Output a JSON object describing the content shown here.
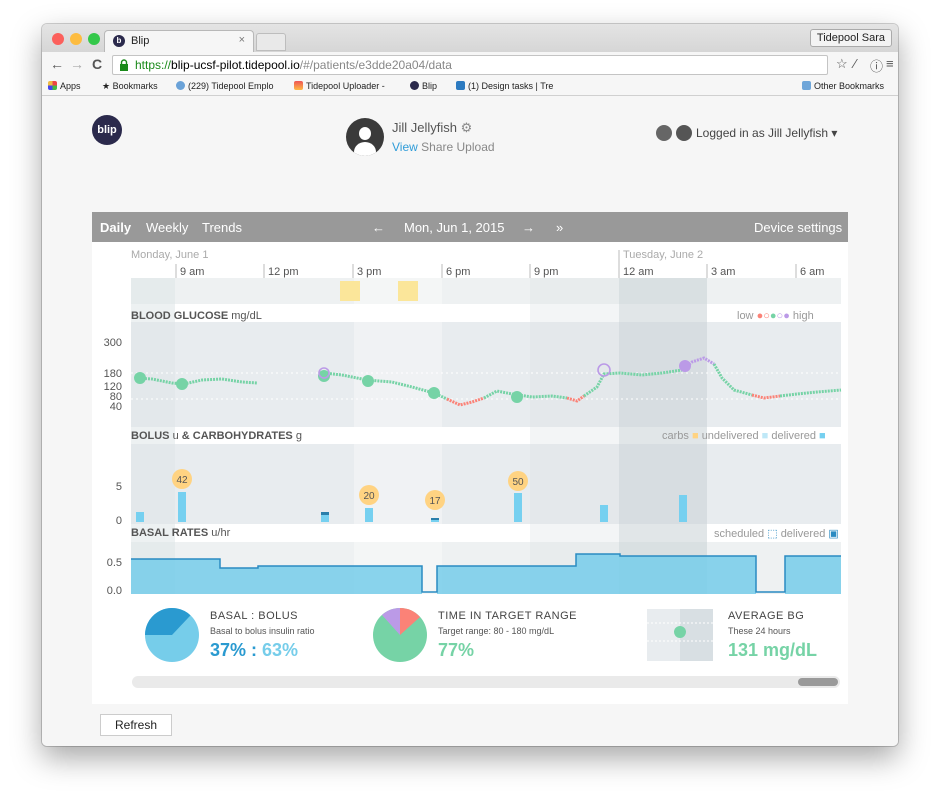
{
  "browser": {
    "tab_title": "Blip",
    "tab_close": "×",
    "profile_name": "Tidepool Sara",
    "url_scheme": "https://",
    "url_host": "blip-ucsf-pilot.tidepool.io",
    "url_path": "/#/patients/e3dde20a04/data",
    "bookmarks": [
      "Apps",
      "Bookmarks",
      "(229) Tidepool Emplo",
      "Tidepool Uploader -",
      "Blip",
      "(1) Design tasks | Tre"
    ],
    "other_bookmarks": "Other Bookmarks"
  },
  "header": {
    "logo_text": "blip",
    "patient_name": "Jill Jellyfish",
    "links": [
      "View",
      "Share",
      "Upload"
    ],
    "logged_in": "Logged in as Jill Jellyfish"
  },
  "nav": {
    "daily": "Daily",
    "weekly": "Weekly",
    "trends": "Trends",
    "prev": "←",
    "date": "Mon, Jun 1, 2015",
    "next": "→",
    "most_recent": "»",
    "device_settings": "Device settings"
  },
  "timeline": {
    "day1": "Monday, June 1",
    "day2": "Tuesday, June 2",
    "ticks": [
      "9 am",
      "12 pm",
      "3 pm",
      "6 pm",
      "9 pm",
      "12 am",
      "3 am",
      "6 am"
    ]
  },
  "blood_glucose": {
    "title": "BLOOD GLUCOSE",
    "unit": "mg/dL",
    "legend_low": "low",
    "legend_high": "high",
    "y_ticks": [
      "300",
      "180",
      "120",
      "80",
      "40"
    ],
    "colors": {
      "low": "#fb8277",
      "target": "#76d3a6",
      "high": "#bb9ae7"
    }
  },
  "bolus": {
    "title": "BOLUS",
    "unit_u": "u",
    "and_carbs": "& CARBOHYDRATES",
    "unit_g": "g",
    "legend_carbs": "carbs",
    "legend_undelivered": "undelivered",
    "legend_delivered": "delivered",
    "y_ticks": [
      "5",
      "0"
    ],
    "carbs": [
      "42",
      "20",
      "17",
      "50"
    ]
  },
  "basal": {
    "title": "BASAL RATES",
    "unit": "u/hr",
    "legend_scheduled": "scheduled",
    "legend_delivered": "delivered",
    "y_ticks": [
      "0.5",
      "0.0"
    ]
  },
  "stats": {
    "basal_bolus": {
      "title": "BASAL : BOLUS",
      "sub": "Basal to bolus insulin ratio",
      "basal_pct": "37%",
      "sep": " : ",
      "bolus_pct": "63%",
      "basal_fraction": 0.37
    },
    "tir": {
      "title": "TIME IN TARGET RANGE",
      "sub": "Target range: 80 - 180 mg/dL",
      "value": "77%"
    },
    "avg": {
      "title": "AVERAGE BG",
      "sub": "These 24 hours",
      "value": "131 mg/dL"
    }
  },
  "refresh_label": "Refresh"
}
